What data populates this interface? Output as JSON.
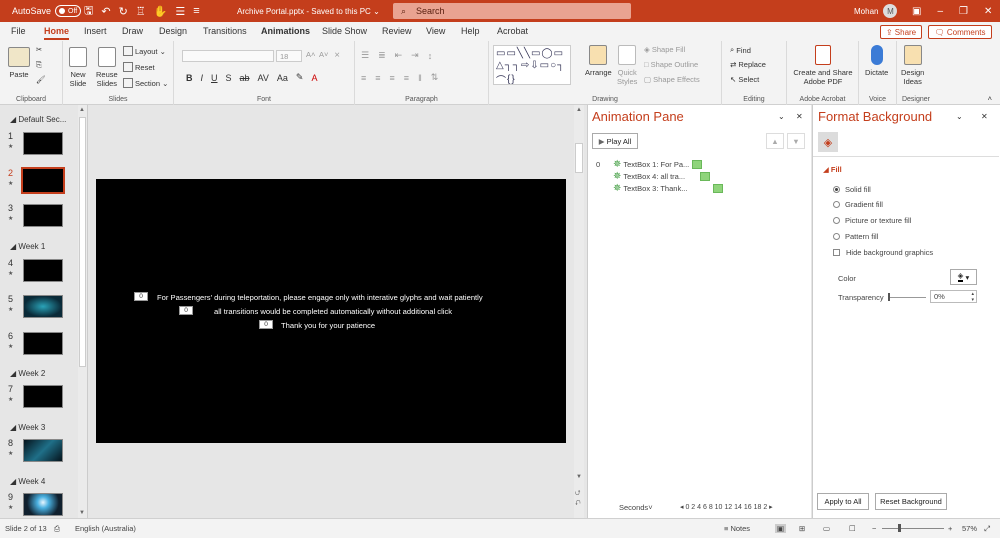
{
  "titlebar": {
    "autosave_label": "AutoSave",
    "autosave_state": "Off",
    "filename": "Archive Portal.pptx",
    "save_status": "Saved to this PC",
    "search_placeholder": "Search",
    "user_name": "Mohan",
    "user_initial": "M"
  },
  "tabs": [
    "File",
    "Home",
    "Insert",
    "Draw",
    "Design",
    "Transitions",
    "Animations",
    "Slide Show",
    "Review",
    "View",
    "Help",
    "Acrobat"
  ],
  "active_tab": "Animations",
  "share_label": "Share",
  "comments_label": "Comments",
  "ribbon": {
    "clipboard": {
      "label": "Clipboard",
      "paste": "Paste"
    },
    "slides": {
      "label": "Slides",
      "new_slide": "New",
      "new_slide2": "Slide",
      "reuse": "Reuse",
      "reuse2": "Slides",
      "layout": "Layout",
      "reset": "Reset",
      "section": "Section"
    },
    "font": {
      "label": "Font",
      "size": "18"
    },
    "paragraph": {
      "label": "Paragraph"
    },
    "drawing": {
      "label": "Drawing",
      "arrange": "Arrange",
      "quick_styles": "Quick",
      "quick_styles2": "Styles",
      "shape_fill": "Shape Fill",
      "shape_outline": "Shape Outline",
      "shape_effects": "Shape Effects"
    },
    "editing": {
      "label": "Editing",
      "find": "Find",
      "replace": "Replace",
      "select": "Select"
    },
    "adobe": {
      "label": "Adobe Acrobat",
      "create": "Create and Share",
      "create2": "Adobe PDF"
    },
    "voice": {
      "label": "Voice",
      "dictate": "Dictate"
    },
    "designer": {
      "label": "Designer",
      "ideas": "Design",
      "ideas2": "Ideas"
    }
  },
  "slide_panel": {
    "sections": [
      "Default Sec...",
      "Week 1",
      "Week 2",
      "Week 3",
      "Week 4"
    ],
    "slides": [
      "1",
      "2",
      "3",
      "4",
      "5",
      "6",
      "7",
      "8",
      "9"
    ],
    "selected": "2"
  },
  "slide": {
    "lines": [
      {
        "order": "0",
        "text": "For Passengers' during teleportation, please engage only with interative glyphs and wait patiently"
      },
      {
        "order": "0",
        "text": "all transitions would be completed automatically without additional click"
      },
      {
        "order": "0",
        "text": "Thank you for your patience"
      }
    ]
  },
  "animation_pane": {
    "title": "Animation Pane",
    "play_all": "Play All",
    "group_num": "0",
    "items": [
      "TextBox 1: For Pa...",
      "TextBox 4: all tra...",
      "TextBox 3: Thank..."
    ],
    "seconds_label": "Seconds",
    "timeline_ticks": "0 2 4 6 8 10 12 14 16 18 2"
  },
  "format_background": {
    "title": "Format Background",
    "section": "Fill",
    "options": [
      "Solid fill",
      "Gradient fill",
      "Picture or texture fill",
      "Pattern fill"
    ],
    "selected": "Solid fill",
    "hide_bg": "Hide background graphics",
    "color_label": "Color",
    "transparency_label": "Transparency",
    "transparency_value": "0%",
    "apply_all": "Apply to All",
    "reset_bg": "Reset Background"
  },
  "statusbar": {
    "slide_info": "Slide 2 of 13",
    "language": "English (Australia)",
    "notes": "Notes",
    "zoom": "57%"
  }
}
